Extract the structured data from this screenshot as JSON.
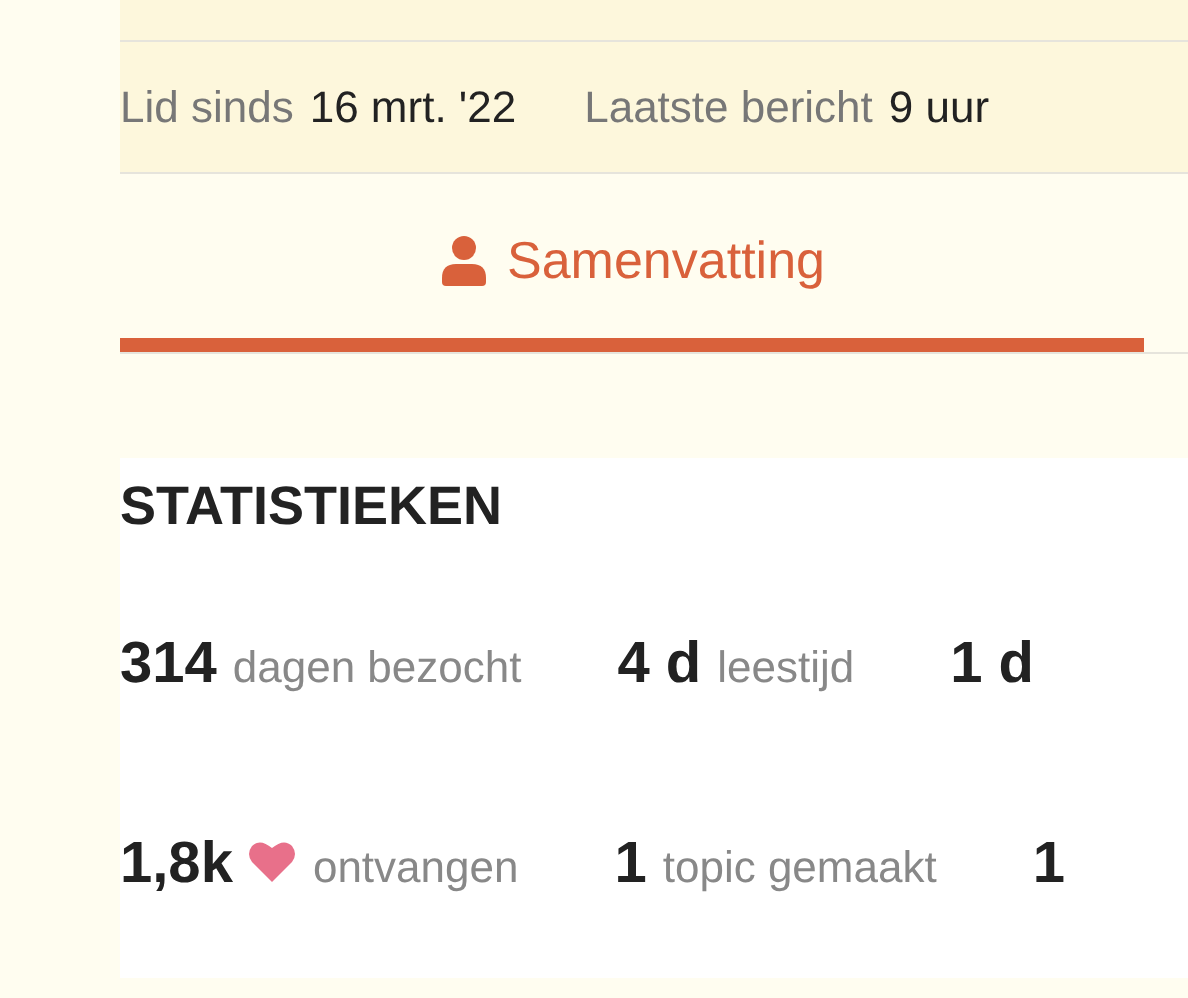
{
  "member_info": [
    {
      "label": "Lid sinds",
      "value": "16 mrt. '22"
    },
    {
      "label": "Laatste bericht",
      "value": "9 uur"
    }
  ],
  "tabs": [
    {
      "label": "Samenvatting",
      "selected": true
    }
  ],
  "statistics": {
    "title": "STATISTIEKEN",
    "rows": [
      [
        {
          "kind": "plain",
          "value": "314",
          "label": "dagen bezocht"
        },
        {
          "kind": "plain",
          "value": "4 d",
          "label": "leestijd"
        },
        {
          "kind": "plain",
          "value": "1 d"
        }
      ],
      [
        {
          "kind": "likes",
          "value": "1,8k",
          "label": "ontvangen"
        },
        {
          "kind": "plain",
          "value": "1",
          "label": "topic gemaakt"
        },
        {
          "kind": "plain",
          "value": "1"
        }
      ]
    ]
  }
}
